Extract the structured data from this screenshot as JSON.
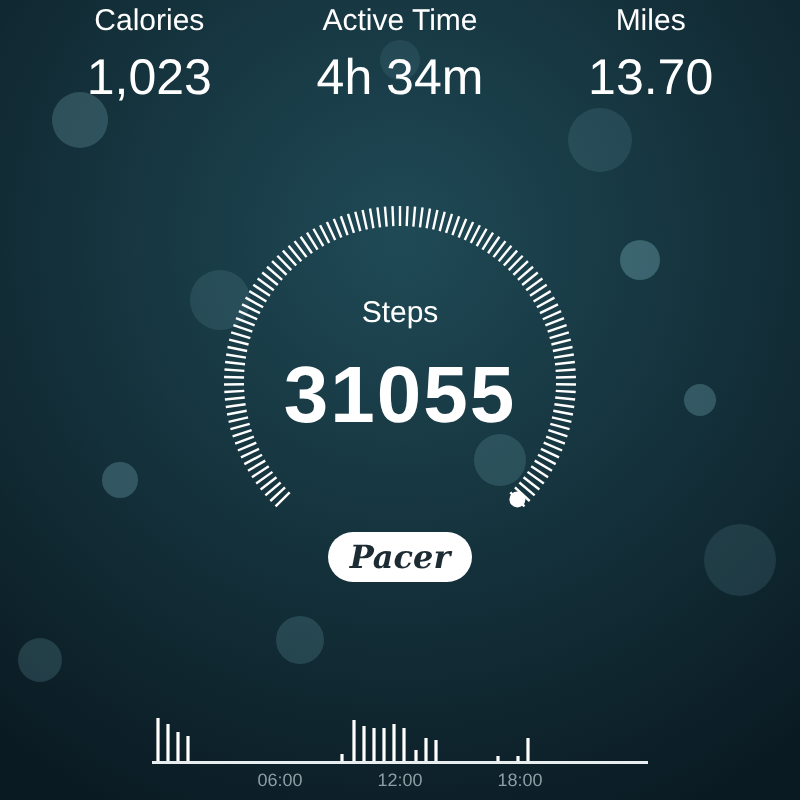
{
  "stats": [
    {
      "label": "Calories",
      "value": "1,023"
    },
    {
      "label": "Active Time",
      "value": "4h 34m"
    },
    {
      "label": "Miles",
      "value": "13.70"
    }
  ],
  "steps": {
    "label": "Steps",
    "value": "31055"
  },
  "brand": "Pacer",
  "activity": {
    "axis_labels": [
      "06:00",
      "12:00",
      "18:00"
    ]
  }
}
